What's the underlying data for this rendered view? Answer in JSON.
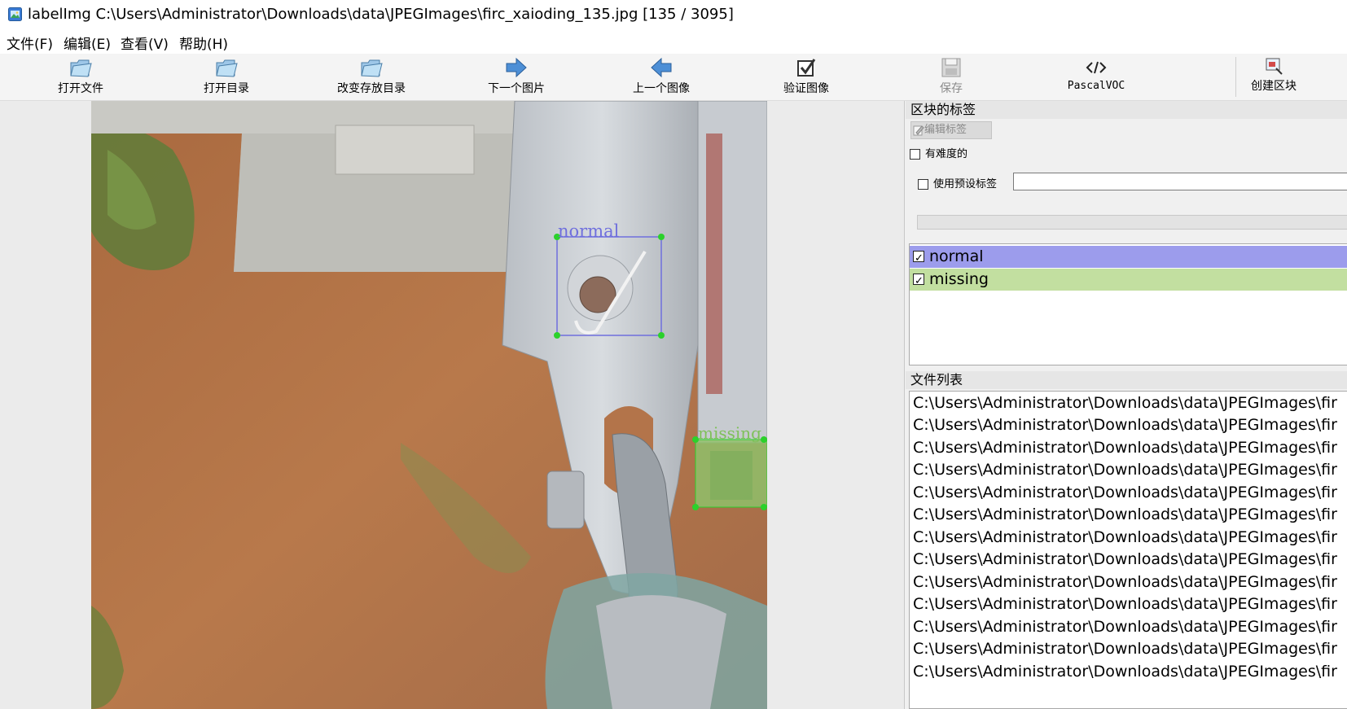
{
  "window": {
    "title": "labelImg C:\\Users\\Administrator\\Downloads\\data\\JPEGImages\\firc_xaioding_135.jpg [135 / 3095]"
  },
  "menu": [
    "文件(F)",
    "编辑(E)",
    "查看(V)",
    "帮助(H)"
  ],
  "toolbar": [
    {
      "label": "打开文件",
      "icon": "folder-open-icon",
      "enabled": true
    },
    {
      "label": "打开目录",
      "icon": "folder-open-icon",
      "enabled": true
    },
    {
      "label": "改变存放目录",
      "icon": "folder-open-icon",
      "enabled": true
    },
    {
      "label": "下一个图片",
      "icon": "arrow-right-icon",
      "enabled": true
    },
    {
      "label": "上一个图像",
      "icon": "arrow-left-icon",
      "enabled": true
    },
    {
      "label": "验证图像",
      "icon": "checkbox-verify-icon",
      "enabled": true
    },
    {
      "label": "保存",
      "icon": "save-icon",
      "enabled": false
    },
    {
      "label": "PascalVOC",
      "icon": "code-tag-icon",
      "enabled": true
    },
    {
      "label": "创建区块",
      "icon": "create-box-icon",
      "enabled": true
    }
  ],
  "canvas": {
    "annotations": [
      {
        "label": "normal",
        "color": "#6f6fdd"
      },
      {
        "label": "missing",
        "color": "#7fc05a"
      }
    ]
  },
  "right_panel": {
    "box_labels_title": "区块的标签",
    "edit_label_button": "编辑标签",
    "difficult_checkbox": "有难度的",
    "use_default_label_checkbox": "使用预设标签",
    "default_label_value": "",
    "labels": [
      {
        "name": "normal",
        "checked": true,
        "bg": "#9c9cec"
      },
      {
        "name": "missing",
        "checked": true,
        "bg": "#c2dfa0"
      }
    ],
    "file_list_title": "文件列表",
    "files": [
      "C:\\Users\\Administrator\\Downloads\\data\\JPEGImages\\fir",
      "C:\\Users\\Administrator\\Downloads\\data\\JPEGImages\\fir",
      "C:\\Users\\Administrator\\Downloads\\data\\JPEGImages\\fir",
      "C:\\Users\\Administrator\\Downloads\\data\\JPEGImages\\fir",
      "C:\\Users\\Administrator\\Downloads\\data\\JPEGImages\\fir",
      "C:\\Users\\Administrator\\Downloads\\data\\JPEGImages\\fir",
      "C:\\Users\\Administrator\\Downloads\\data\\JPEGImages\\fir",
      "C:\\Users\\Administrator\\Downloads\\data\\JPEGImages\\fir",
      "C:\\Users\\Administrator\\Downloads\\data\\JPEGImages\\fir",
      "C:\\Users\\Administrator\\Downloads\\data\\JPEGImages\\fir",
      "C:\\Users\\Administrator\\Downloads\\data\\JPEGImages\\fir",
      "C:\\Users\\Administrator\\Downloads\\data\\JPEGImages\\fir",
      "C:\\Users\\Administrator\\Downloads\\data\\JPEGImages\\fir"
    ]
  }
}
